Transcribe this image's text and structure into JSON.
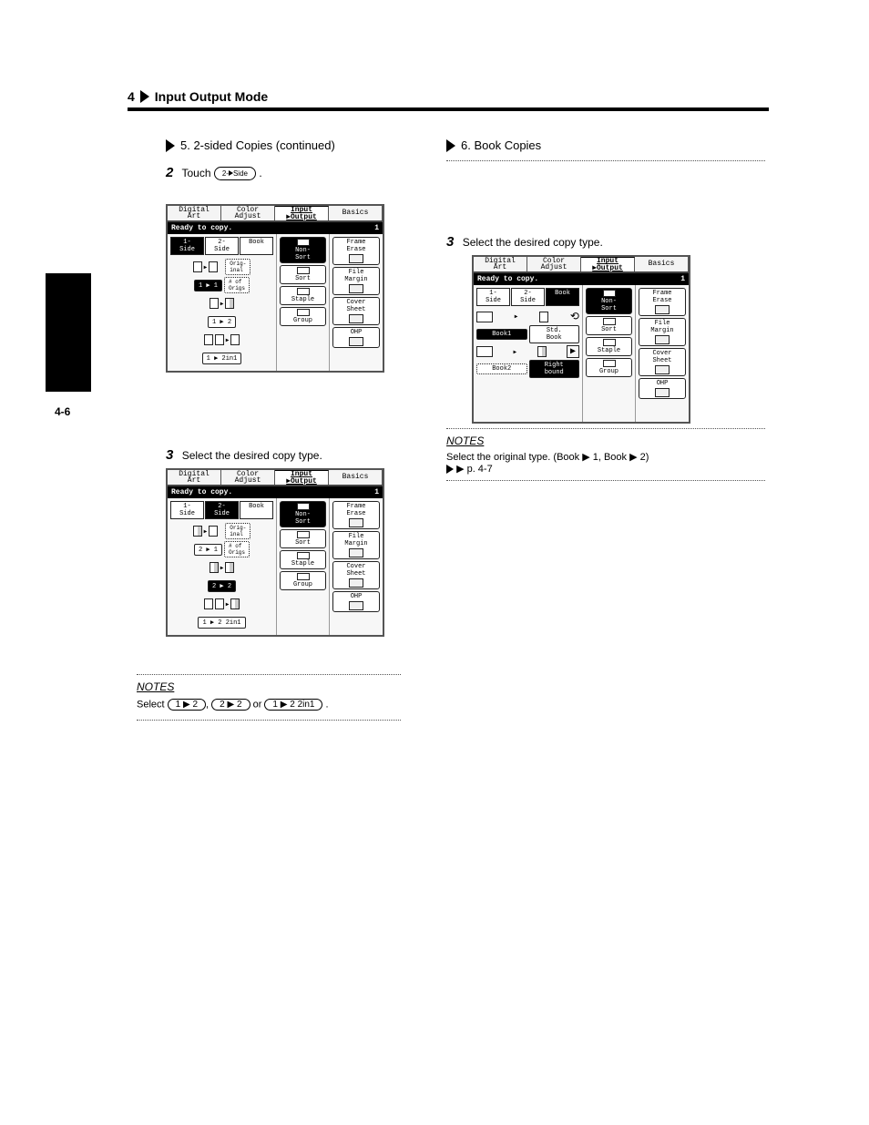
{
  "chapter": {
    "number": "4",
    "title": "Input Output Mode",
    "page_number": "4-6"
  },
  "section5": {
    "title": "5. 2-sided Copies (continued)",
    "step2": {
      "num": "2",
      "text_a": "Touch",
      "btn": "2-Side",
      "text_b": "."
    },
    "step3": {
      "num": "3",
      "text": "Select the desired copy type."
    },
    "note": {
      "heading": "NOTES",
      "body": "Select",
      "btns": [
        "1 ▶ 2",
        "2 ▶ 2",
        "1 ▶ 2 2in1"
      ],
      "tail": "."
    }
  },
  "section6": {
    "title": "6. Book Copies",
    "step3": {
      "num": "3",
      "text": "Select the desired copy type."
    },
    "note": {
      "heading": "NOTES",
      "body_line1": "Select the original type. (Book ▶ 1, Book ▶ 2)",
      "body_line2": "▶ p. 4-7"
    }
  },
  "panel": {
    "tabs": [
      "Digital\nArt",
      "Color\nAdjust",
      "Input\n▶Output",
      "Basics"
    ],
    "status": "Ready to copy.",
    "count": "1",
    "side_tabs": [
      "1-\nSide",
      "2-\nSide",
      "Book"
    ],
    "left_options_1side": {
      "orig_label": "Orig-\ninal",
      "rows": [
        {
          "a": "1",
          "b": "1",
          "sel": true,
          "extra": "# of\nOrigs"
        },
        {
          "a": "1",
          "b": "2"
        },
        {
          "a": "1",
          "b": "2in1"
        }
      ]
    },
    "left_options_2side": {
      "orig_label": "Orig-\ninal",
      "rows": [
        {
          "a": "2",
          "b": "1",
          "extra": "# of\nOrigs"
        },
        {
          "a": "2",
          "b": "2",
          "sel": true
        },
        {
          "a": "1",
          "b": "2 2in1"
        }
      ]
    },
    "left_options_book": {
      "rows": [
        {
          "label": "Book1",
          "sel": true,
          "r": "Std.\nBook"
        },
        {
          "label": "Book2",
          "dot": true,
          "r": "Right\nbound",
          "rsel": true
        }
      ]
    },
    "mid": [
      "Non-\nSort",
      "Sort",
      "Staple",
      "Group"
    ],
    "right": [
      "Frame\nErase",
      "File\nMargin",
      "Cover\nSheet",
      "OHP"
    ]
  }
}
